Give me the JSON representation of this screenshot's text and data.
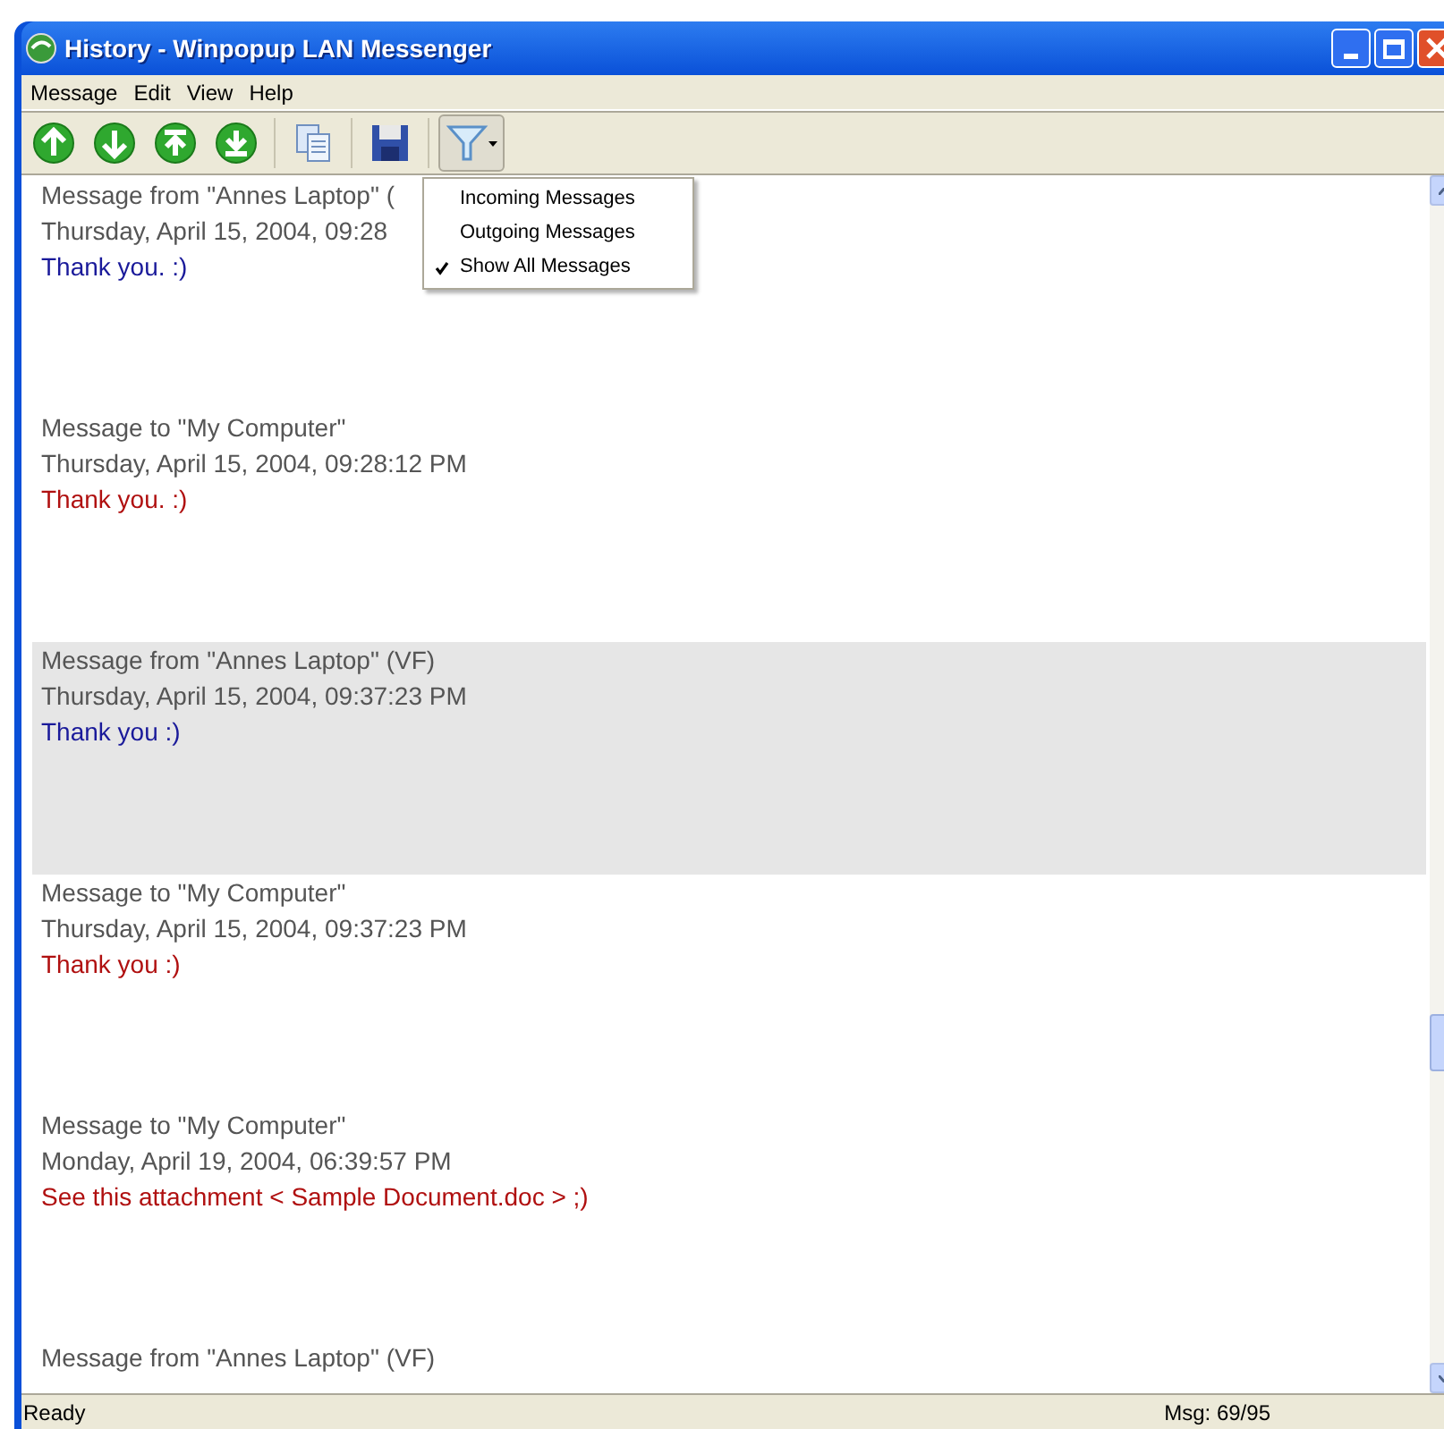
{
  "window": {
    "title": "History - Winpopup LAN Messenger"
  },
  "menu_bar": [
    "Message",
    "Edit",
    "View",
    "Help"
  ],
  "toolbar": [
    {
      "kind": "up"
    },
    {
      "kind": "down"
    },
    {
      "kind": "top"
    },
    {
      "kind": "bottom"
    },
    {
      "kind": "copy"
    },
    {
      "kind": "save"
    },
    {
      "kind": "filter",
      "pressed": true
    }
  ],
  "filter_menu": [
    {
      "label": "Incoming Messages",
      "checked": false
    },
    {
      "label": "Outgoing Messages",
      "checked": false
    },
    {
      "label": "Show All Messages",
      "checked": true
    }
  ],
  "messages": [
    {
      "kind": "incoming",
      "selected": false,
      "header": "Message from \"Annes Laptop\" (",
      "date": "Thursday, April 15, 2004, 09:28",
      "text": "Thank you. :)"
    },
    {
      "kind": "outgoing",
      "selected": false,
      "header": "Message to \"My Computer\"",
      "date": "Thursday, April 15, 2004, 09:28:12 PM",
      "text": "Thank you. :)"
    },
    {
      "kind": "incoming",
      "selected": true,
      "header": "Message from \"Annes Laptop\" (VF)",
      "date": "Thursday, April 15, 2004, 09:37:23 PM",
      "text": "Thank you :)"
    },
    {
      "kind": "outgoing",
      "selected": false,
      "header": "Message to \"My Computer\"",
      "date": "Thursday, April 15, 2004, 09:37:23 PM",
      "text": "Thank you :)"
    },
    {
      "kind": "outgoing",
      "selected": false,
      "header": "Message to \"My Computer\"",
      "date": "Monday, April 19, 2004, 06:39:57 PM",
      "text": "See this attachment < Sample Document.doc > ;)"
    },
    {
      "kind": "incoming",
      "selected": false,
      "header": "Message from \"Annes Laptop\" (VF)"
    }
  ],
  "status_bar": {
    "status": "Ready",
    "count": "Msg: 69/95"
  }
}
